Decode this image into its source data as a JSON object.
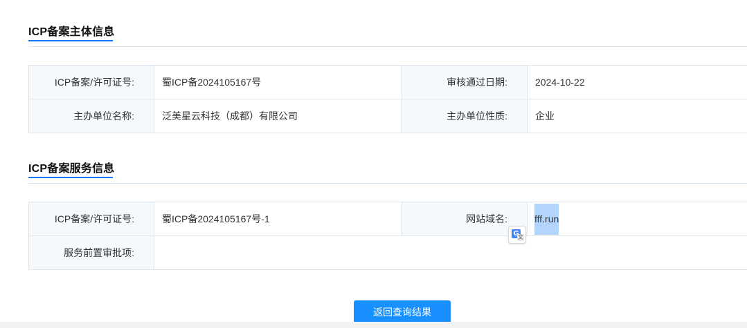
{
  "subject_section": {
    "title": "ICP备案主体信息",
    "rows": [
      {
        "label1": "ICP备案/许可证号:",
        "value1": "蜀ICP备2024105167号",
        "label2": "审核通过日期:",
        "value2": "2024-10-22"
      },
      {
        "label1": "主办单位名称:",
        "value1": "泛美星云科技（成都）有限公司",
        "label2": "主办单位性质:",
        "value2": "企业"
      }
    ]
  },
  "service_section": {
    "title": "ICP备案服务信息",
    "rows": [
      {
        "label1": "ICP备案/许可证号:",
        "value1": "蜀ICP备2024105167号-1",
        "label2": "网站域名:",
        "value2": "fff.run"
      },
      {
        "label1": "服务前置审批项:",
        "value1": ""
      }
    ]
  },
  "translate_popup": {
    "icon": "google-translate-icon",
    "g_glyph": "G",
    "x_glyph": "文"
  },
  "back_button": {
    "label": "返回查询结果"
  },
  "colors": {
    "accent": "#1890ff",
    "underline": "#1677ff",
    "label_bg": "#f6f9fc",
    "border": "#dde6ee",
    "selection": "#b3d4fc"
  }
}
